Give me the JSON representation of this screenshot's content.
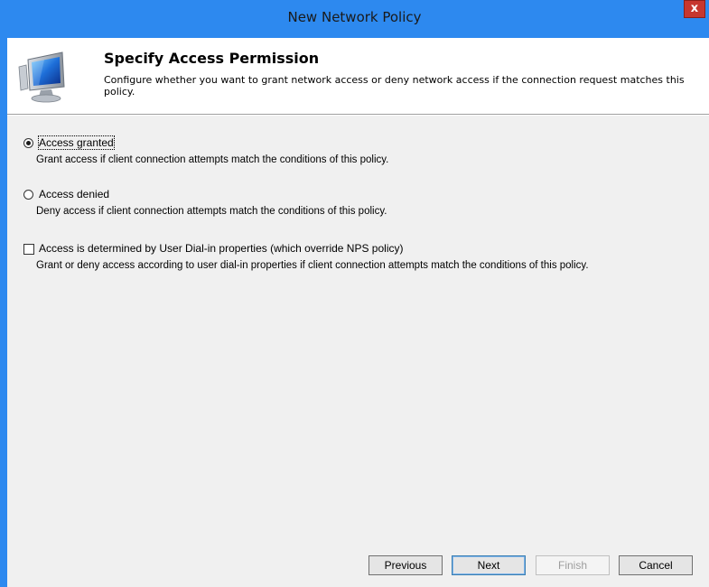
{
  "window": {
    "title": "New Network Policy",
    "close_label": "x"
  },
  "header": {
    "title": "Specify Access Permission",
    "description": "Configure whether you want to grant network access or deny network access if the connection request matches this policy.",
    "icon": "computer-monitor-icon"
  },
  "options": {
    "access_granted": {
      "label": "Access granted",
      "description": "Grant access if client connection attempts match the conditions of this policy.",
      "selected": true
    },
    "access_denied": {
      "label": "Access denied",
      "description": "Deny access if client connection attempts match the conditions of this policy.",
      "selected": false
    },
    "dialin": {
      "label": "Access is determined by User Dial-in properties (which override NPS policy)",
      "description": "Grant or deny access according to user dial-in properties if client connection attempts match the conditions of this policy.",
      "checked": false
    }
  },
  "footer": {
    "previous_label": "Previous",
    "next_label": "Next",
    "finish_label": "Finish",
    "cancel_label": "Cancel"
  }
}
